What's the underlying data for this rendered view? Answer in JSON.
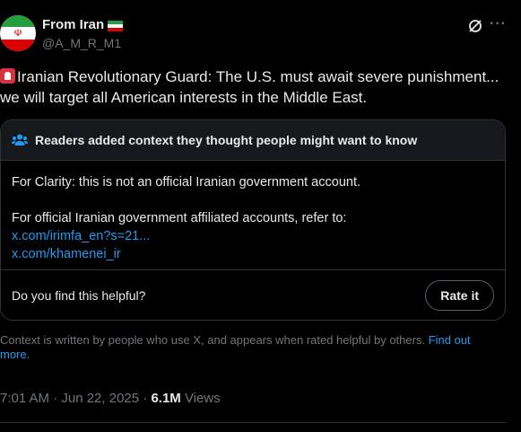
{
  "author": {
    "name": "From Iran",
    "handle": "@A_M_R_M1",
    "avatar_icon": "iran-flag-avatar",
    "flag_icon": "iran-flag"
  },
  "tweet": {
    "emoji_icon": "police-light-icon",
    "text": "Iranian Revolutionary Guard: The U.S. must await severe punishment... we will target all American interests in the Middle East."
  },
  "community_note": {
    "header": "Readers added context they thought people might want to know",
    "line1": "For Clarity: this is not an official Iranian government account.",
    "line2": "For official Iranian government affiliated accounts, refer to:",
    "links": [
      "x.com/irimfa_en?s=21...",
      "x.com/khamenei_ir"
    ],
    "helpful_prompt": "Do you find this helpful?",
    "rate_label": "Rate it"
  },
  "disclaimer": {
    "text": "Context is written by people who use X, and appears when rated helpful by others.",
    "link": "Find out more."
  },
  "meta": {
    "time": "7:01 AM · Jun 22, 2025 · ",
    "views_count": "6.1M",
    "views_label": " Views"
  },
  "colors": {
    "background": "#000000",
    "text": "#e7e9ea",
    "muted": "#71767b",
    "link": "#1d9bf0",
    "border": "#2f3336"
  }
}
